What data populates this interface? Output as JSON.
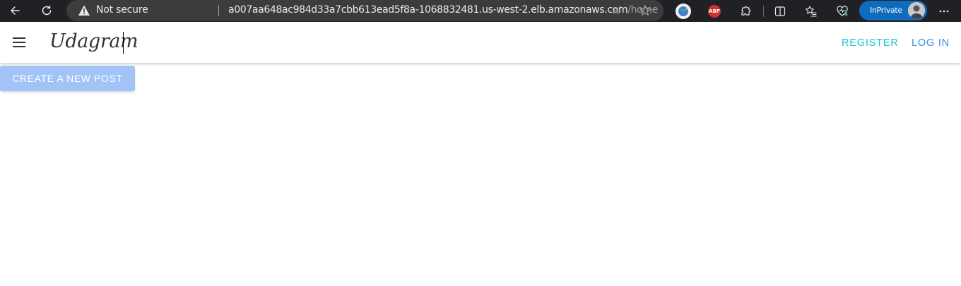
{
  "browser": {
    "security_label": "Not secure",
    "url_host": "a007aa648ac984d33a7cbb613ead5f8a-1068832481.us-west-2.elb.amazonaws.com",
    "url_path": "/home",
    "abp_label": "ABP",
    "profile_label": "InPrivate"
  },
  "app": {
    "brand": "Udagram",
    "nav": {
      "register": "REGISTER",
      "login": "LOG IN"
    },
    "create_post_label": "CREATE A NEW POST"
  },
  "colors": {
    "register": "#19c3cf",
    "login": "#3a8ee6",
    "create_button": "#a2c3f8",
    "inprivate": "#0f6cbd"
  },
  "icons": [
    "back-icon",
    "refresh-icon",
    "warning-icon",
    "read-aloud-icon",
    "favorite-star-icon",
    "extension-globe-icon",
    "adblock-icon",
    "extensions-icon",
    "split-screen-icon",
    "favorites-icon",
    "browser-essentials-icon",
    "more-icon",
    "menu-icon"
  ]
}
